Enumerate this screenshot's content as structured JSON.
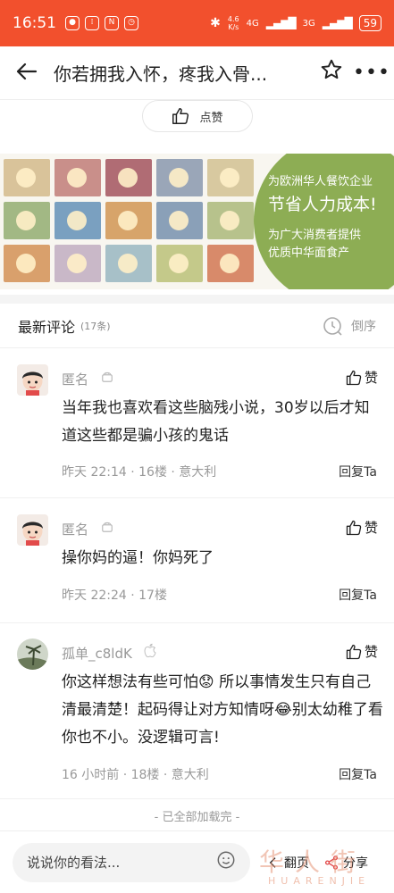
{
  "status_bar": {
    "time": "16:51",
    "net_speed_value": "4.6",
    "net_speed_unit": "K/s",
    "net_type_1": "4G",
    "net_type_2": "3G",
    "battery": "59"
  },
  "nav": {
    "title": "你若拥我入怀，疼我入骨..."
  },
  "like_button": {
    "label": "点赞"
  },
  "ad": {
    "line1": "为欧洲华人餐饮企业",
    "line2": "节省人力成本!",
    "line3": "为广大消费者提供",
    "line4": "优质中华面食产"
  },
  "comments_header": {
    "title": "最新评论",
    "count": "(17条)",
    "sort_label": "倒序"
  },
  "comments": [
    {
      "name": "匿名",
      "like_label": "赞",
      "text": "当年我也喜欢看这些脑残小说，30岁以后才知道这些都是骗小孩的鬼话",
      "meta": "昨天 22:14 · 16楼 · 意大利",
      "reply": "回复Ta"
    },
    {
      "name": "匿名",
      "like_label": "赞",
      "text": "操你妈的逼！你妈死了",
      "meta": "昨天 22:24 · 17楼",
      "reply": "回复Ta"
    },
    {
      "name": "孤单_c8ldK",
      "like_label": "赞",
      "text": "你这样想法有些可怕😟 所以事情发生只有自己清最清楚！起码得让对方知情呀😂别太幼稚了看你也不小。没逻辑可言!",
      "meta": "16 小时前 · 18楼 · 意大利",
      "reply": "回复Ta"
    }
  ],
  "end_note": "- 已全部加载完 -",
  "bottom_bar": {
    "input_placeholder": "说说你的看法...",
    "page_label": "翻页",
    "share_label": "分享"
  },
  "watermark": {
    "main": "华人街",
    "sub": "HUARENJIE"
  },
  "colors": {
    "accent": "#f2502d",
    "ad_green": "#8dad54"
  }
}
